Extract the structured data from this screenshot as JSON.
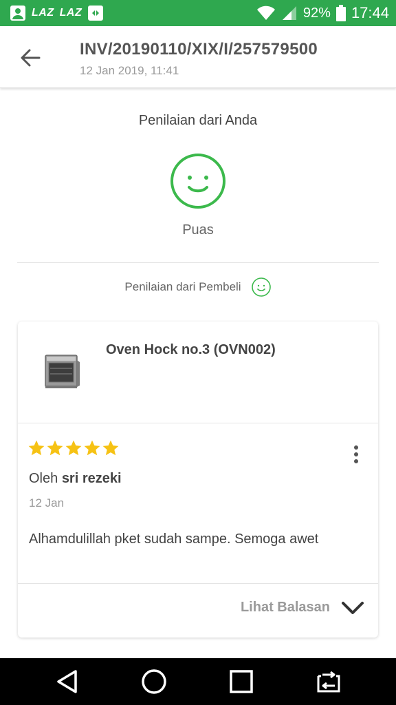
{
  "status_bar": {
    "laz_1": "LAZ",
    "laz_2": "LAZ",
    "battery_percent": "92%",
    "time": "17:44",
    "icons": [
      "account-icon",
      "laz-icon",
      "laz-icon",
      "photo-app-icon",
      "wifi-icon",
      "signal-icon",
      "battery-icon"
    ]
  },
  "header": {
    "title": "INV/20190110/XIX/I/257579500",
    "subtitle": "12 Jan 2019, 11:41",
    "back_icon": "arrow-left-icon"
  },
  "seller_rating": {
    "heading": "Penilaian dari Anda",
    "icon": "smiley-icon",
    "value": "Puas",
    "accent": "#3cb94c"
  },
  "buyer_rating": {
    "label": "Penilaian dari Pembeli",
    "icon": "smiley-icon"
  },
  "review": {
    "product_name": "Oven Hock no.3 (OVN002)",
    "stars": 5,
    "star_max": 5,
    "star_color": "#f6c214",
    "by_prefix": "Oleh",
    "reviewer": "sri rezeki",
    "date": "12 Jan",
    "text": "Alhamdulillah pket sudah sampe. Semoga awet",
    "see_reply": "Lihat Balasan"
  },
  "nav_bar": {
    "icons": [
      "back-triangle-icon",
      "home-circle-icon",
      "recents-square-icon",
      "switch-app-icon"
    ]
  },
  "colors": {
    "status_bar": "#2fa84f",
    "accent_green": "#3cb94c"
  }
}
